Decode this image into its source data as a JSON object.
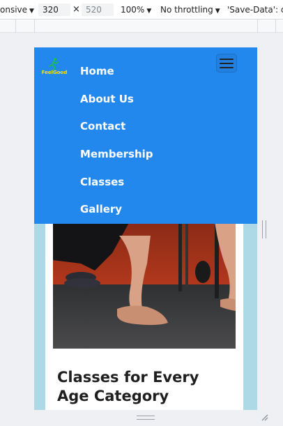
{
  "devtools": {
    "device_label": "onsive",
    "width_value": "320",
    "times": "×",
    "height_value": "520",
    "zoom": "100%",
    "throttling": "No throttling",
    "save_data": "'Save-Data': de"
  },
  "navbar": {
    "brand": "FeelGood",
    "menu_label": "Toggle navigation",
    "items": [
      "Home",
      "About Us",
      "Contact",
      "Membership",
      "Classes",
      "Gallery"
    ]
  },
  "card": {
    "title": "Classes for Every Age Category"
  },
  "colors": {
    "navbar": "#2388ee",
    "page_bg": "#add8e6",
    "brand_text": "#f4e600"
  }
}
